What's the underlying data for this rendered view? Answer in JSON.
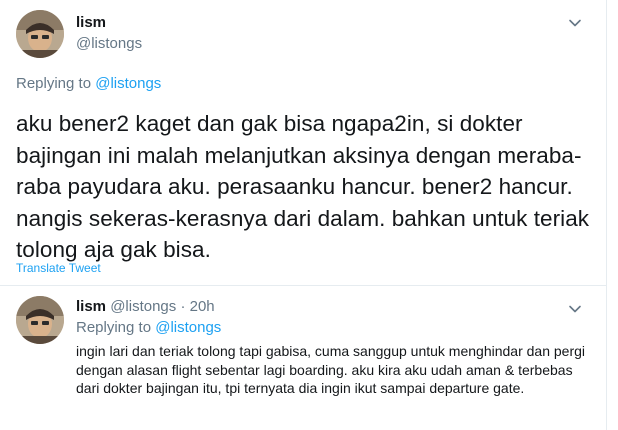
{
  "main_tweet": {
    "name": "lism",
    "handle": "@listongs",
    "replying_prefix": "Replying to",
    "replying_to": "@listongs",
    "text": "aku bener2 kaget dan gak bisa ngapa2in, si dokter bajingan ini malah melanjutkan aksinya dengan meraba-raba payudara aku. perasaanku hancur. bener2 hancur. nangis sekeras-kerasnya dari dalam. bahkan untuk teriak tolong aja gak bisa.",
    "translate_label": "Translate Tweet"
  },
  "reply_tweet": {
    "name": "lism",
    "handle": "@listongs",
    "separator": "·",
    "time": "20h",
    "replying_prefix": "Replying to",
    "replying_to": "@listongs",
    "text": "ingin lari dan teriak tolong tapi gabisa, cuma sanggup untuk menghindar dan pergi dengan alasan flight sebentar lagi boarding. aku kira aku udah aman & terbebas dari dokter bajingan itu, tpi ternyata dia ingin ikut sampai departure gate."
  },
  "icons": {
    "avatar": "avatar-photo",
    "more": "chevron-down-icon"
  },
  "colors": {
    "text": "#14171a",
    "secondary": "#657786",
    "link": "#1da1f2",
    "border": "#e6ecf0"
  }
}
